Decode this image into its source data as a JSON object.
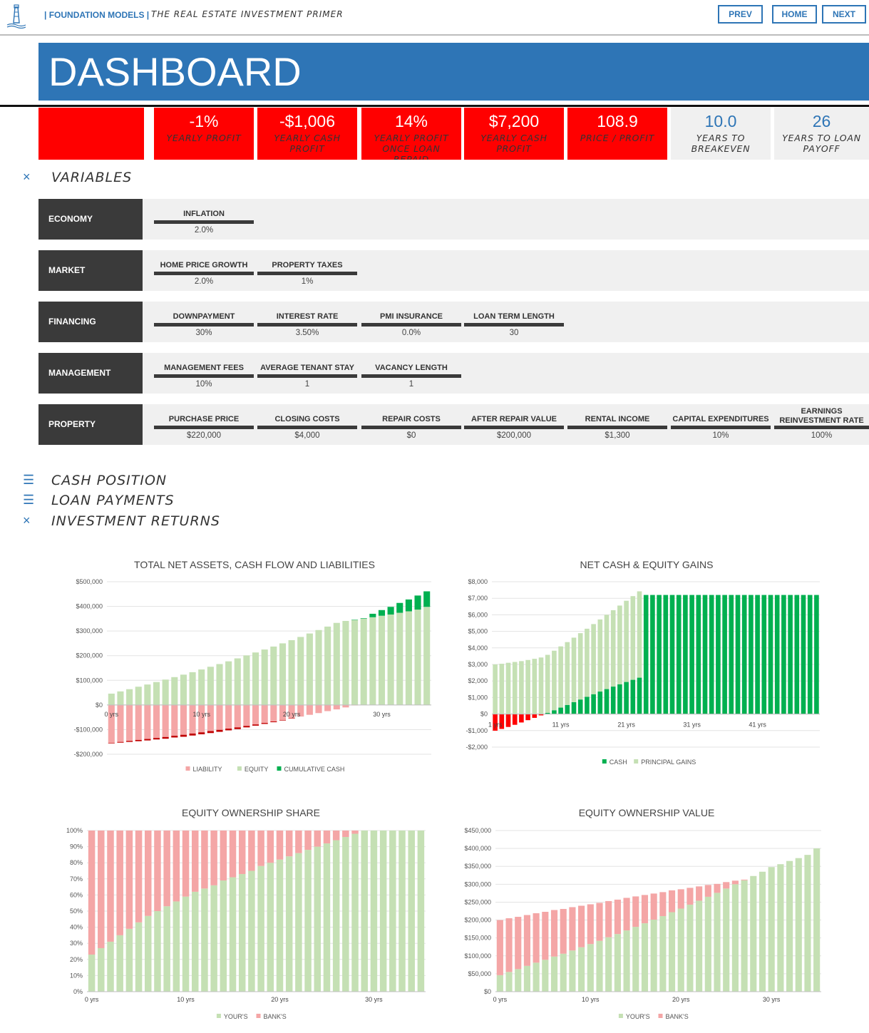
{
  "header": {
    "brand": "| FOUNDATION MODELS |",
    "subtitle": "THE REAL ESTATE INVESTMENT PRIMER",
    "nav": {
      "prev": "PREV",
      "home": "HOME",
      "next": "NEXT"
    }
  },
  "banner": {
    "title": "DASHBOARD"
  },
  "kpis": [
    {
      "value": "-1%",
      "label": "YEARLY PROFIT",
      "style": "red"
    },
    {
      "value": "-$1,006",
      "label": "YEARLY CASH PROFIT",
      "style": "red"
    },
    {
      "value": "14%",
      "label": "YEARLY PROFIT ONCE LOAN REPAID",
      "style": "red"
    },
    {
      "value": "$7,200",
      "label": "YEARLY CASH PROFIT",
      "style": "red"
    },
    {
      "value": "108.9",
      "label": "PRICE / PROFIT",
      "style": "red"
    },
    {
      "value": "10.0",
      "label": "YEARS TO BREAKEVEN",
      "style": "grey"
    },
    {
      "value": "26",
      "label": "YEARS TO LOAN PAYOFF",
      "style": "grey"
    }
  ],
  "sections": {
    "variables": {
      "icon": "×",
      "title": "VARIABLES"
    },
    "cash_position": {
      "icon": "☰",
      "title": "CASH POSITION"
    },
    "loan_payments": {
      "icon": "☰",
      "title": "LOAN PAYMENTS"
    },
    "investment_returns": {
      "icon": "×",
      "title": "INVESTMENT RETURNS"
    }
  },
  "variables": {
    "economy": {
      "label": "ECONOMY",
      "items": [
        {
          "name": "INFLATION",
          "value": "2.0%"
        }
      ]
    },
    "market": {
      "label": "MARKET",
      "items": [
        {
          "name": "HOME PRICE GROWTH",
          "value": "2.0%"
        },
        {
          "name": "PROPERTY TAXES",
          "value": "1%"
        }
      ]
    },
    "financing": {
      "label": "FINANCING",
      "items": [
        {
          "name": "DOWNPAYMENT",
          "value": "30%"
        },
        {
          "name": "INTEREST RATE",
          "value": "3.50%"
        },
        {
          "name": "PMI INSURANCE",
          "value": "0.0%"
        },
        {
          "name": "LOAN TERM LENGTH",
          "value": "30"
        }
      ]
    },
    "management": {
      "label": "MANAGEMENT",
      "items": [
        {
          "name": "MANAGEMENT FEES",
          "value": "10%"
        },
        {
          "name": "AVERAGE TENANT STAY",
          "value": "1"
        },
        {
          "name": "VACANCY LENGTH",
          "value": "1"
        }
      ]
    },
    "property": {
      "label": "PROPERTY",
      "items": [
        {
          "name": "PURCHASE PRICE",
          "value": "$220,000"
        },
        {
          "name": "CLOSING COSTS",
          "value": "$4,000"
        },
        {
          "name": "REPAIR COSTS",
          "value": "$0"
        },
        {
          "name": "AFTER REPAIR VALUE",
          "value": "$200,000"
        },
        {
          "name": "RENTAL INCOME",
          "value": "$1,300"
        },
        {
          "name": "CAPITAL EXPENDITURES",
          "value": "10%"
        },
        {
          "name": "EARNINGS REINVESTMENT RATE",
          "value": "100%"
        }
      ]
    }
  },
  "colors": {
    "blue": "#2e75b6",
    "red": "#ff0000",
    "liability": "#f4a6a6",
    "equity": "#c5e0b4",
    "cash": "#00b050",
    "dark": "#3a3a3a"
  },
  "chart_data": [
    {
      "type": "bar",
      "title": "TOTAL NET ASSETS, CASH FLOW AND LIABILITIES",
      "ylim": [
        -200000,
        500000
      ],
      "yticks": [
        -200000,
        -100000,
        0,
        100000,
        200000,
        300000,
        400000,
        500000
      ],
      "ytick_labels": [
        "-$200,000",
        "-$100,000",
        "$0",
        "$100,000",
        "$200,000",
        "$300,000",
        "$400,000",
        "$500,000"
      ],
      "xtick_labels": [
        {
          "i": 0,
          "label": "0 yrs"
        },
        {
          "i": 10,
          "label": "10 yrs"
        },
        {
          "i": 20,
          "label": "20 yrs"
        },
        {
          "i": 30,
          "label": "30 yrs"
        }
      ],
      "bars": 36,
      "legend": [
        "LIABILITY",
        "EQUITY",
        "CUMULATIVE CASH"
      ],
      "legend_position": "bottom",
      "series": [
        {
          "name": "LIABILITY",
          "values": [
            -154000,
            -150000,
            -146000,
            -142000,
            -138000,
            -134000,
            -130000,
            -125000,
            -121000,
            -116000,
            -111000,
            -106000,
            -101000,
            -96000,
            -91000,
            -85000,
            -79000,
            -73000,
            -67000,
            -61000,
            -54000,
            -47000,
            -40000,
            -33000,
            -25000,
            -18000,
            -10000,
            -2000,
            0,
            0,
            0,
            0,
            0,
            0,
            0,
            0
          ]
        },
        {
          "name": "EQUITY",
          "values": [
            46000,
            55000,
            64000,
            74000,
            83000,
            93000,
            103000,
            113000,
            123000,
            133000,
            144000,
            155000,
            166000,
            177000,
            189000,
            201000,
            213000,
            225000,
            237000,
            250000,
            263000,
            276000,
            290000,
            304000,
            318000,
            333000,
            341000,
            345000,
            350000,
            356000,
            362000,
            367000,
            374000,
            380000,
            387000,
            398000
          ]
        },
        {
          "name": "CUMULATIVE CASH",
          "values": [
            -2000,
            -3000,
            -4000,
            -5000,
            -6000,
            -6000,
            -7000,
            -7000,
            -8000,
            -8000,
            -8000,
            -8000,
            -8000,
            -7000,
            -7000,
            -6000,
            -5000,
            -4000,
            -3000,
            -2000,
            -1000,
            0,
            0,
            0,
            0,
            0,
            0,
            1000,
            2000,
            14000,
            23000,
            31000,
            40000,
            48000,
            57000,
            63000
          ]
        }
      ]
    },
    {
      "type": "bar",
      "title": "NET CASH & EQUITY GAINS",
      "ylim": [
        -2000,
        8000
      ],
      "yticks": [
        -2000,
        -1000,
        0,
        1000,
        2000,
        3000,
        4000,
        5000,
        6000,
        7000,
        8000
      ],
      "ytick_labels": [
        "-$2,000",
        "-$1,000",
        "$0",
        "$1,000",
        "$2,000",
        "$3,000",
        "$4,000",
        "$5,000",
        "$6,000",
        "$7,000",
        "$8,000"
      ],
      "xtick_labels": [
        {
          "i": 0,
          "label": "1 yrs"
        },
        {
          "i": 10,
          "label": "11 yrs"
        },
        {
          "i": 20,
          "label": "21 yrs"
        },
        {
          "i": 30,
          "label": "31 yrs"
        },
        {
          "i": 40,
          "label": "41 yrs"
        }
      ],
      "bars": 50,
      "legend": [
        "CASH",
        "PRINCIPAL GAINS"
      ],
      "legend_position": "bottom",
      "series": [
        {
          "name": "CASH",
          "values": [
            -1006,
            -900,
            -780,
            -650,
            -510,
            -370,
            -230,
            -80,
            70,
            230,
            390,
            550,
            720,
            880,
            1040,
            1200,
            1360,
            1510,
            1660,
            1800,
            1940,
            2070,
            2200,
            7200,
            7200,
            7200,
            7200,
            7200,
            7200,
            7200,
            7200,
            7200,
            7200,
            7200,
            7200,
            7200,
            7200,
            7200,
            7200,
            7200,
            7200,
            7200,
            7200,
            7200,
            7200,
            7200,
            7200,
            7200,
            7200,
            7200
          ]
        },
        {
          "name": "PRINCIPAL GAINS",
          "values": [
            3000,
            3040,
            3100,
            3150,
            3200,
            3270,
            3340,
            3420,
            3510,
            3600,
            3700,
            3800,
            3900,
            4010,
            4120,
            4240,
            4360,
            4490,
            4620,
            4760,
            4910,
            5060,
            5220,
            0,
            0,
            0,
            0,
            0,
            0,
            0,
            0,
            0,
            0,
            0,
            0,
            0,
            0,
            0,
            0,
            0,
            0,
            0,
            0,
            0,
            0,
            0,
            0,
            0,
            0,
            0
          ]
        }
      ]
    },
    {
      "type": "bar",
      "title": "EQUITY OWNERSHIP SHARE",
      "ylim": [
        0,
        100
      ],
      "yticks": [
        0,
        10,
        20,
        30,
        40,
        50,
        60,
        70,
        80,
        90,
        100
      ],
      "ytick_labels": [
        "0%",
        "10%",
        "20%",
        "30%",
        "40%",
        "50%",
        "60%",
        "70%",
        "80%",
        "90%",
        "100%"
      ],
      "xtick_labels": [
        {
          "i": 0,
          "label": "0 yrs"
        },
        {
          "i": 10,
          "label": "10 yrs"
        },
        {
          "i": 20,
          "label": "20 yrs"
        },
        {
          "i": 30,
          "label": "30 yrs"
        }
      ],
      "bars": 36,
      "legend": [
        "YOUR'S",
        "BANK'S"
      ],
      "legend_position": "bottom",
      "series": [
        {
          "name": "YOUR'S",
          "values": [
            23,
            27,
            31,
            35,
            39,
            43,
            47,
            50,
            53,
            56,
            59,
            62,
            64,
            66,
            69,
            71,
            73,
            75,
            78,
            80,
            82,
            84,
            86,
            88,
            90,
            92,
            94,
            96,
            98,
            100,
            100,
            100,
            100,
            100,
            100,
            100
          ]
        },
        {
          "name": "BANK'S",
          "values": [
            77,
            73,
            69,
            65,
            61,
            57,
            53,
            50,
            47,
            44,
            41,
            38,
            36,
            34,
            31,
            29,
            27,
            25,
            22,
            20,
            18,
            16,
            14,
            12,
            10,
            8,
            6,
            4,
            2,
            0,
            0,
            0,
            0,
            0,
            0,
            0
          ]
        }
      ]
    },
    {
      "type": "bar",
      "title": "EQUITY OWNERSHIP VALUE",
      "ylim": [
        0,
        450000
      ],
      "yticks": [
        0,
        50000,
        100000,
        150000,
        200000,
        250000,
        300000,
        350000,
        400000,
        450000
      ],
      "ytick_labels": [
        "$0",
        "$50,000",
        "$100,000",
        "$150,000",
        "$200,000",
        "$250,000",
        "$300,000",
        "$350,000",
        "$400,000",
        "$450,000"
      ],
      "xtick_labels": [
        {
          "i": 0,
          "label": "0 yrs"
        },
        {
          "i": 10,
          "label": "10 yrs"
        },
        {
          "i": 20,
          "label": "20 yrs"
        },
        {
          "i": 30,
          "label": "30 yrs"
        }
      ],
      "bars": 36,
      "legend": [
        "YOUR'S",
        "BANK'S"
      ],
      "legend_position": "bottom",
      "series": [
        {
          "name": "YOUR'S",
          "values": [
            46000,
            55000,
            63000,
            72000,
            81000,
            89000,
            98000,
            106000,
            115000,
            124000,
            133000,
            142000,
            152000,
            161000,
            171000,
            181000,
            191000,
            201000,
            211000,
            222000,
            232000,
            243000,
            254000,
            265000,
            276000,
            288000,
            300000,
            311000,
            323000,
            335000,
            348000,
            356000,
            365000,
            373000,
            382000,
            400000
          ]
        },
        {
          "name": "BANK'S",
          "values": [
            154000,
            150000,
            146000,
            142000,
            138000,
            134000,
            130000,
            125000,
            121000,
            116000,
            111000,
            106000,
            101000,
            96000,
            91000,
            85000,
            79000,
            73000,
            67000,
            61000,
            54000,
            47000,
            40000,
            33000,
            25000,
            18000,
            10000,
            2000,
            0,
            0,
            0,
            0,
            0,
            0,
            0,
            0
          ]
        }
      ]
    }
  ]
}
